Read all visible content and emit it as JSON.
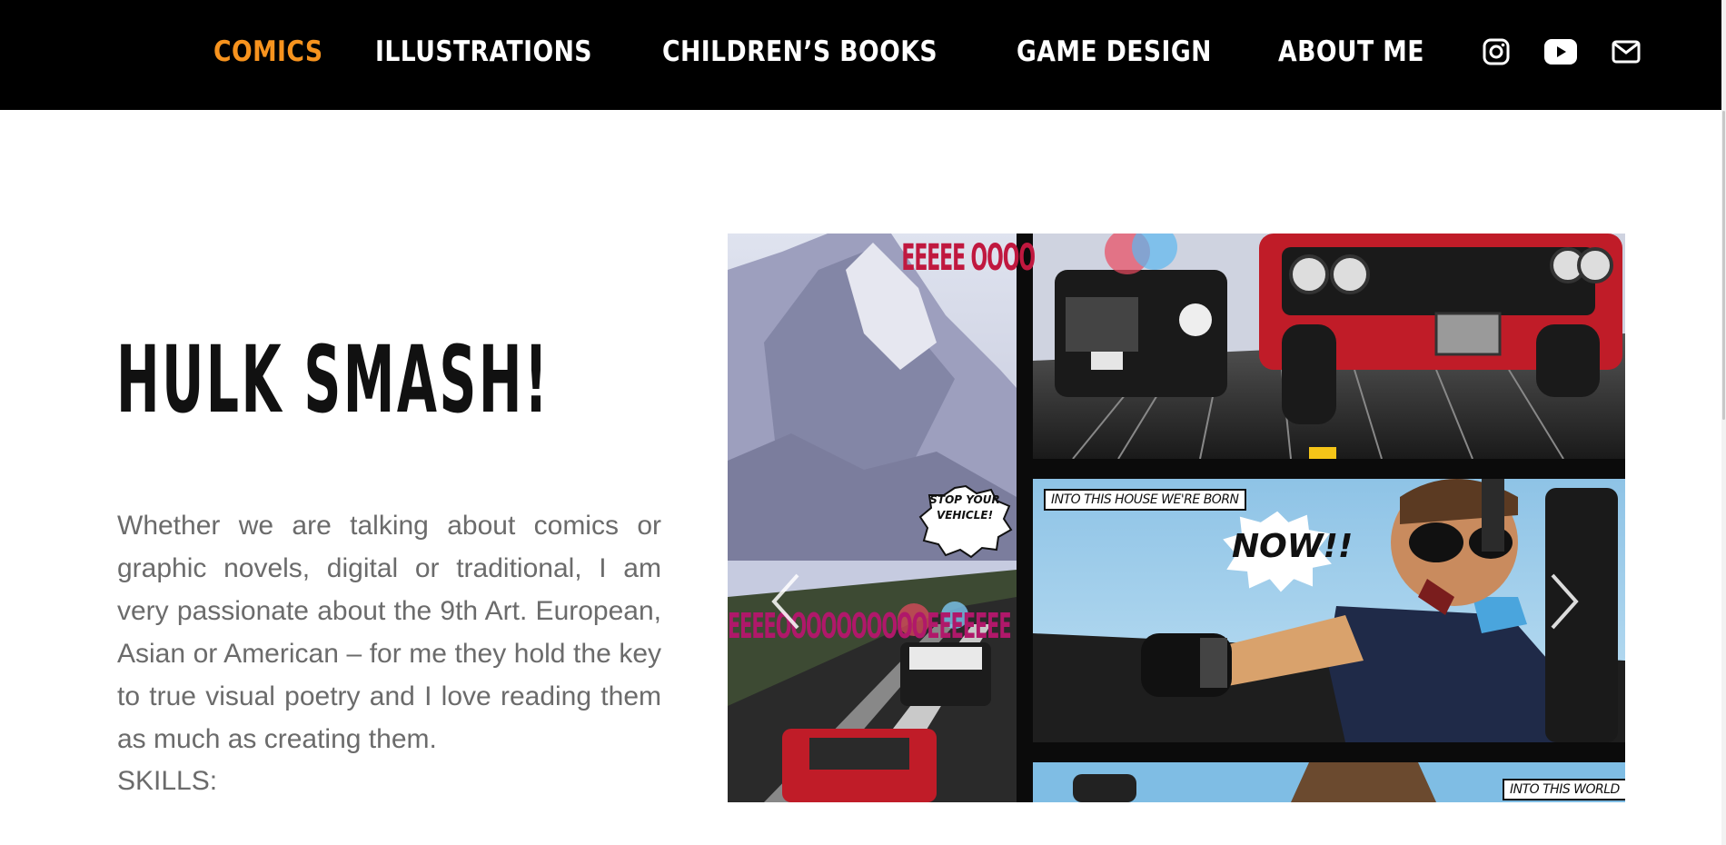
{
  "nav": {
    "items": [
      {
        "label": "COMICS",
        "active": true
      },
      {
        "label": "ILLUSTRATIONS",
        "active": false
      },
      {
        "label": "CHILDREN’S BOOKS",
        "active": false
      },
      {
        "label": "GAME DESIGN",
        "active": false
      },
      {
        "label": "ABOUT ME",
        "active": false
      }
    ],
    "icons": [
      "instagram-icon",
      "youtube-icon",
      "mail-icon"
    ],
    "active_color": "#f7931e",
    "background": "#000000"
  },
  "hero": {
    "title": "HULK SMASH!",
    "intro": "Whether we are talking about comics or graphic novels, digital or traditional, I am very passionate about the 9th Art. European, Asian or American – for me they hold the key to true visual poetry and I love reading them as much as creating them.",
    "skills_label": "SKILLS:"
  },
  "slider": {
    "captions": {
      "top": "INTO THIS HOUSE WE'RE BORN",
      "bottom": "INTO THIS WORLD"
    },
    "speech": {
      "stop": "STOP YOUR VEHICLE!",
      "now": "NOW!!"
    },
    "sound_effect": "EEEEOOOOOOOOOOEEEEEEE",
    "sound_effect_top": "EEEEE OOOO",
    "prev_icon": "chevron-left-icon",
    "next_icon": "chevron-right-icon"
  }
}
